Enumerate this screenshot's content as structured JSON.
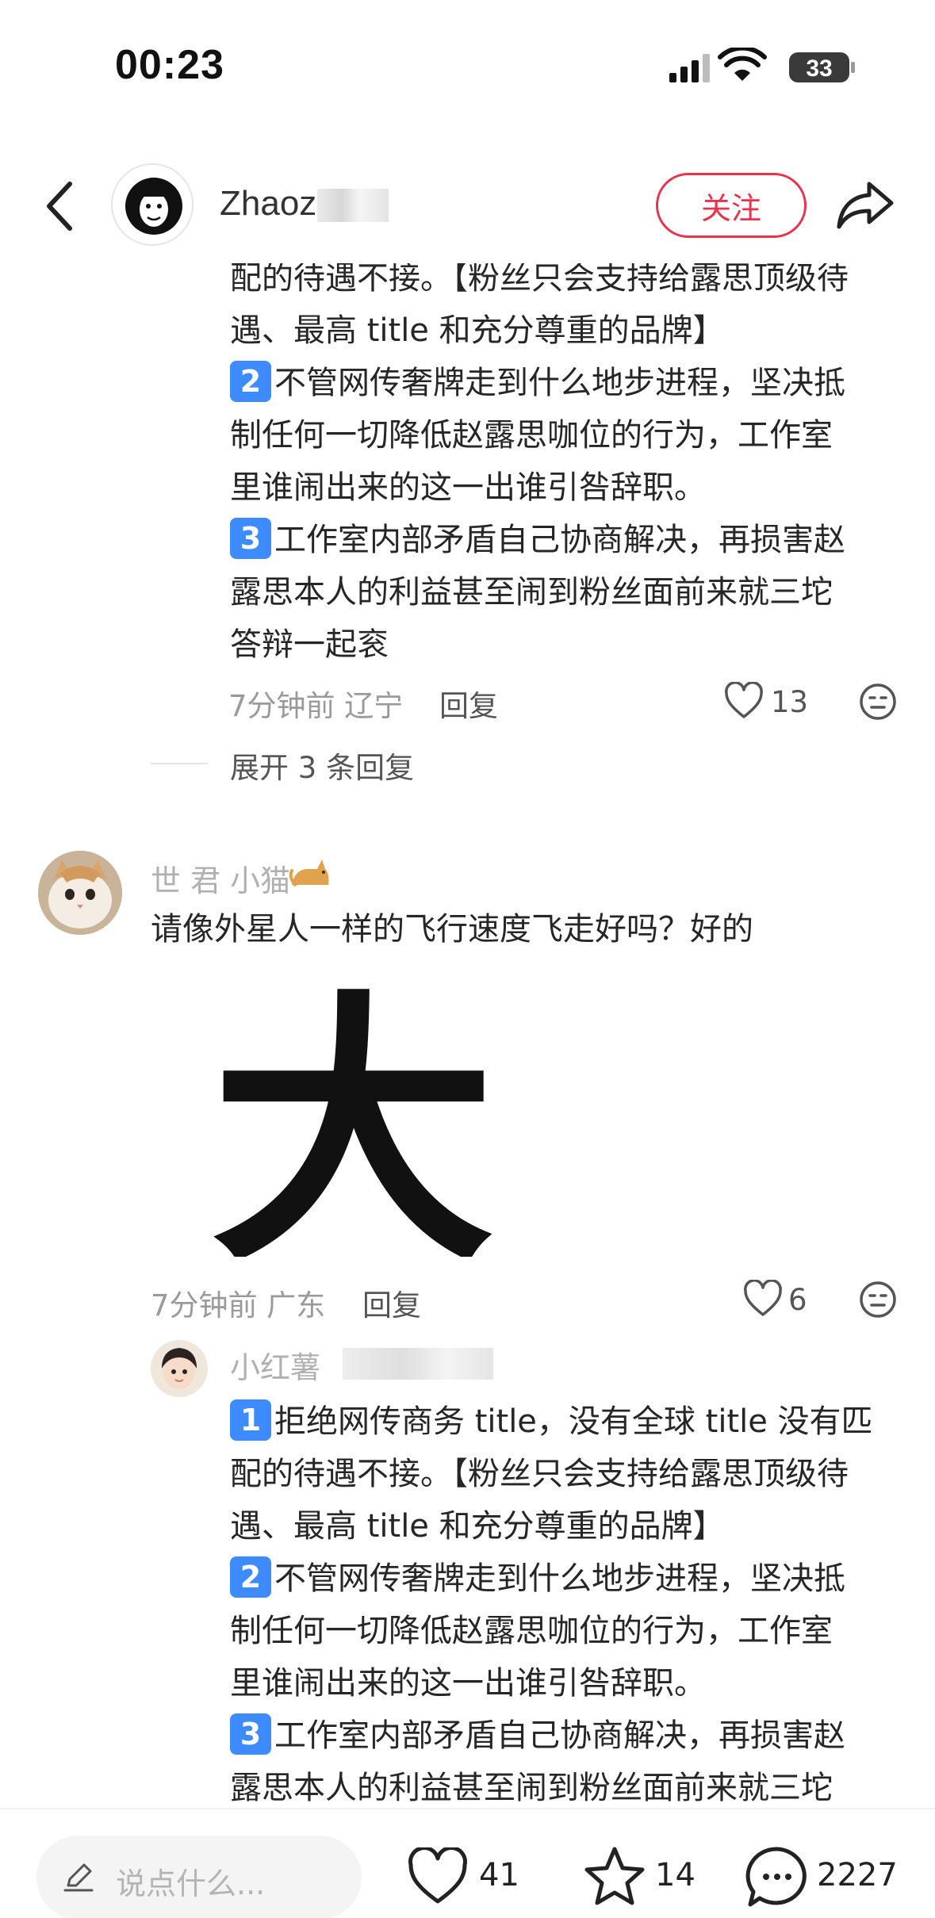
{
  "status_bar": {
    "time": "00:23",
    "battery": "33"
  },
  "header": {
    "back_icon": "chevron-left-icon",
    "username": "Zhaoz",
    "follow_label": "关注",
    "share_icon": "share-arrow-icon"
  },
  "comment_1": {
    "lines": [
      "配的待遇不接。【粉丝只会支持给露思顶级待",
      "遇、最高 title 和充分尊重的品牌】",
      "不管网传奢牌走到什么地步进程，坚决抵",
      "制任何一切降低赵露思咖位的行为，工作室",
      "里谁闹出来的这一出谁引咎辞职。",
      "工作室内部矛盾自己协商解决，再损害赵",
      "露思本人的利益甚至闹到粉丝面前来就三坨",
      "答辩一起衮"
    ],
    "num_2": "2",
    "num_3": "3",
    "time_location": "7分钟前 辽宁",
    "reply_label": "回复",
    "likes": "13",
    "expand_label": "展开 3 条回复"
  },
  "comment_2": {
    "username": "世 君 小猫",
    "text": "请像外星人一样的飞行速度飞走好吗？好的",
    "sticker_char": "大",
    "time_location": "7分钟前 广东",
    "reply_label": "回复",
    "likes": "6"
  },
  "reply_1": {
    "username": "小红薯",
    "lines": [
      "拒绝网传商务 title，没有全球 title 没有匹",
      "配的待遇不接。【粉丝只会支持给露思顶级待",
      "遇、最高 title 和充分尊重的品牌】",
      "不管网传奢牌走到什么地步进程，坚决抵",
      "制任何一切降低赵露思咖位的行为，工作室",
      "里谁闹出来的这一出谁引咎辞职。",
      "工作室内部矛盾自己协商解决，再损害赵",
      "露思本人的利益甚至闹到粉丝面前来就三坨"
    ],
    "num_1": "1",
    "num_2": "2",
    "num_3": "3"
  },
  "bottom_bar": {
    "input_placeholder": "说点什么...",
    "likes": "41",
    "favorites": "14",
    "comments": "2227"
  },
  "colors": {
    "accent_red": "#e9334c",
    "number_badge": "#3d8bff",
    "meta_gray": "#9a9a9a"
  }
}
